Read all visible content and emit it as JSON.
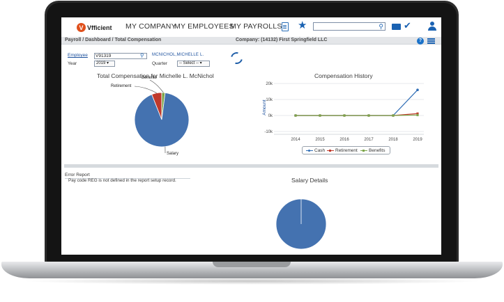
{
  "brand": {
    "logo_text": "Vfficient",
    "logo_letter": "V"
  },
  "nav": {
    "items": [
      "MY COMPANY",
      "MY EMPLOYEES",
      "MY PAYROLLS"
    ]
  },
  "breadcrumb": "Payroll / Dashboard / Total Compensation",
  "company": "Company: (14132) First Springfield LLC",
  "help_label": "?",
  "form": {
    "employee_label": "Employee",
    "employee_value": "V91319",
    "employee_name": "MCNICHOL,MICHELLE L.",
    "year_label": "Year",
    "year_value": "2019",
    "quarter_label": "Quarter",
    "quarter_value": "-- Select --"
  },
  "error_report": {
    "title": "Error Report",
    "message": "Pay code REG is not defined in the report setup record."
  },
  "colors": {
    "cash": "#2f6db5",
    "retirement": "#c0392b",
    "benefits": "#7da54a",
    "pie_primary": "#4472b0",
    "brand": "#e0501c"
  },
  "chart_data": [
    {
      "type": "pie",
      "title": "Total Compensation for Michelle L. McNichol",
      "labels": [
        "Salary",
        "Retirement",
        "Benefits"
      ],
      "values": [
        92,
        6,
        2
      ]
    },
    {
      "type": "line",
      "title": "Compensation History",
      "xlabel": "",
      "ylabel": "Amount",
      "x": [
        "2014",
        "2015",
        "2016",
        "2017",
        "2018",
        "2019"
      ],
      "yticks": [
        "20k",
        "10k",
        "0k",
        "-10k"
      ],
      "ylim": [
        -10000,
        20000
      ],
      "grid": true,
      "legend": "bottom",
      "series": [
        {
          "name": "Cash",
          "values": [
            0,
            0,
            0,
            0,
            0,
            16000
          ]
        },
        {
          "name": "Retirement",
          "values": [
            0,
            0,
            0,
            0,
            0,
            1200
          ]
        },
        {
          "name": "Benefits",
          "values": [
            0,
            0,
            0,
            0,
            0,
            300
          ]
        }
      ]
    },
    {
      "type": "pie",
      "title": "Salary Details",
      "labels": [],
      "values": [
        100
      ]
    }
  ]
}
